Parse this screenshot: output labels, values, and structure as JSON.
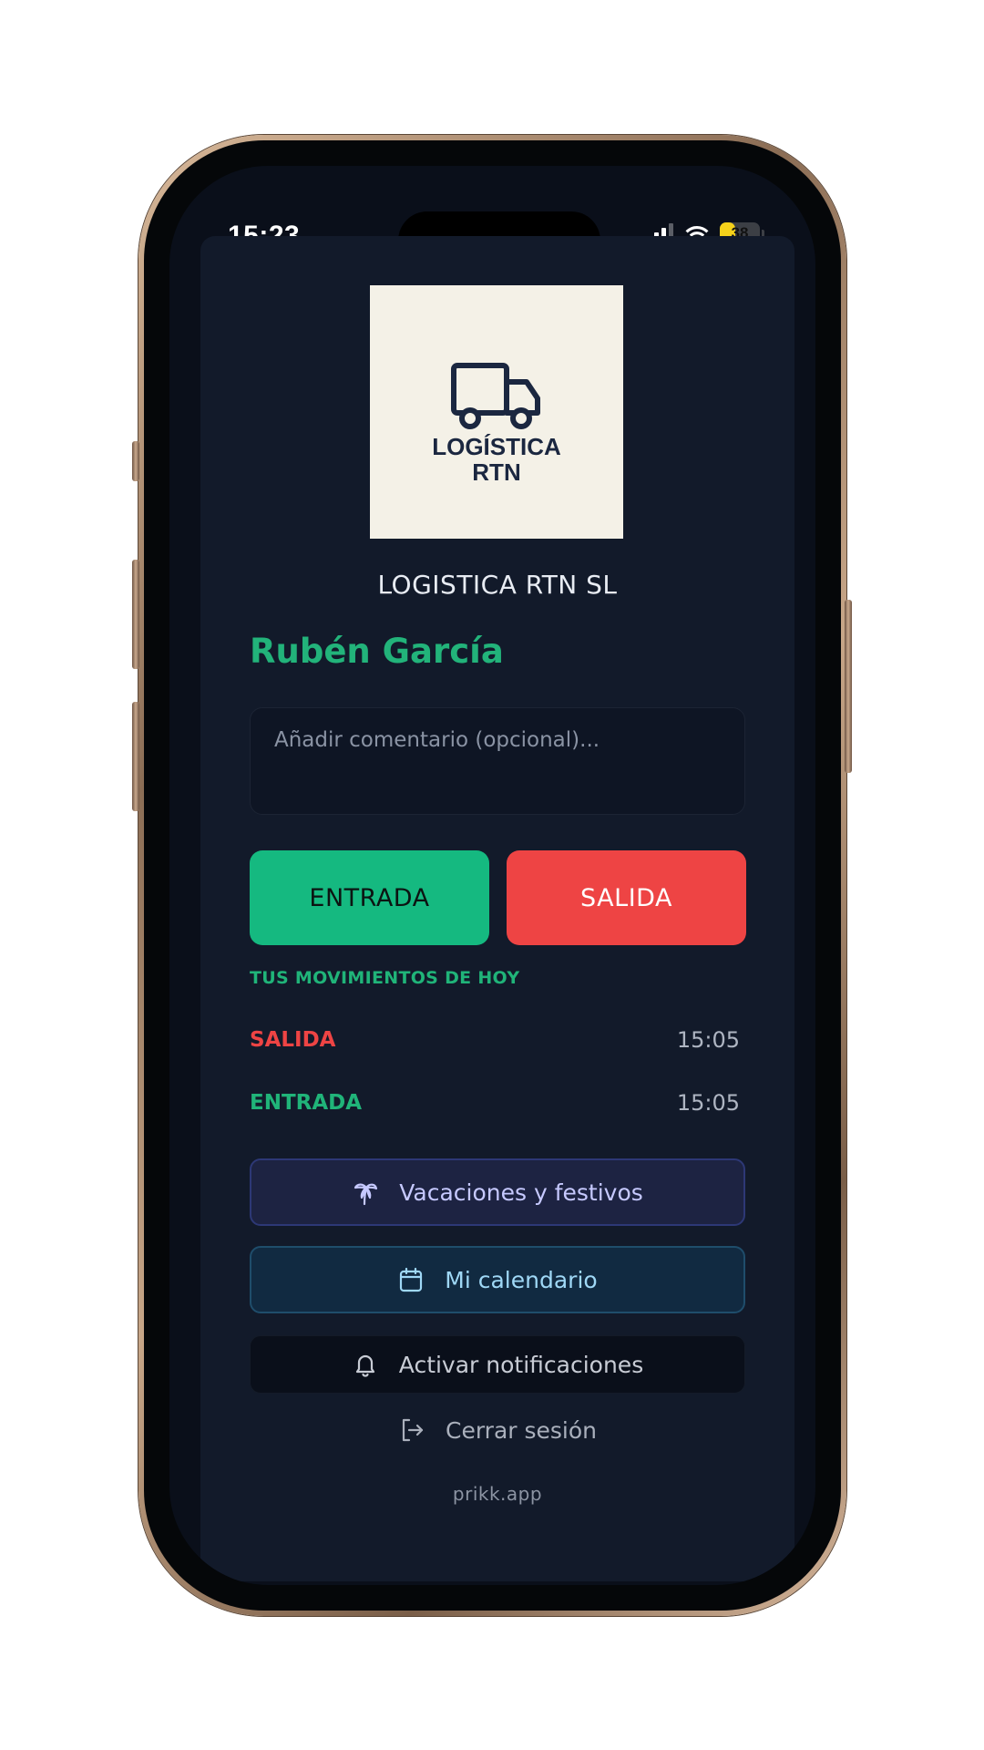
{
  "status_bar": {
    "time": "15:23",
    "battery_level": "38",
    "battery_fraction": 0.38
  },
  "logo": {
    "line1": "LOGÍSTICA",
    "line2": "RTN"
  },
  "company_name": "LOGISTICA RTN SL",
  "user_name": "Rubén García",
  "comment": {
    "value": "",
    "placeholder": "Añadir comentario (opcional)..."
  },
  "actions": {
    "entrada_label": "ENTRADA",
    "salida_label": "SALIDA"
  },
  "movements": {
    "title": "TUS MOVIMIENTOS DE HOY",
    "items": [
      {
        "type": "SALIDA",
        "time": "15:05",
        "color": "#ee4444"
      },
      {
        "type": "ENTRADA",
        "time": "15:05",
        "color": "#20b479"
      }
    ]
  },
  "links": {
    "vacations": {
      "label": "Vacaciones y festivos",
      "icon": "palm-tree-icon"
    },
    "calendar": {
      "label": "Mi calendario",
      "icon": "calendar-icon"
    },
    "notifications": {
      "label": "Activar notificaciones",
      "icon": "bell-icon"
    },
    "logout": {
      "label": "Cerrar sesión",
      "icon": "logout-icon"
    }
  },
  "footer": "prikk.app",
  "colors": {
    "accent_green": "#15b980",
    "accent_red": "#ee4444",
    "background": "#121a2a",
    "frame": "#c7a688"
  }
}
